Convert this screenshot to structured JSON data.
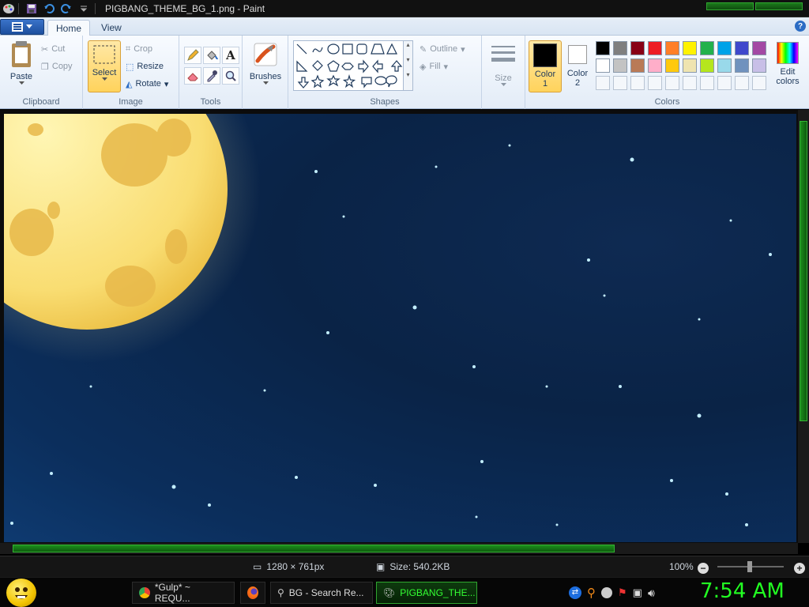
{
  "window": {
    "title": "PIGBANG_THEME_BG_1.png - Paint"
  },
  "tabs": {
    "home": "Home",
    "view": "View"
  },
  "clipboard": {
    "paste": "Paste",
    "cut": "Cut",
    "copy": "Copy",
    "label": "Clipboard"
  },
  "image_group": {
    "select": "Select",
    "crop": "Crop",
    "resize": "Resize",
    "rotate": "Rotate",
    "label": "Image"
  },
  "tools": {
    "label": "Tools"
  },
  "brushes": {
    "label": "Brushes"
  },
  "shapes": {
    "outline": "Outline",
    "fill": "Fill",
    "label": "Shapes"
  },
  "size": {
    "label": "Size"
  },
  "colors": {
    "color1_label": "Color",
    "color1_num": "1",
    "color2_label": "Color",
    "color2_num": "2",
    "edit_label_1": "Edit",
    "edit_label_2": "colors",
    "label": "Colors",
    "color1_value": "#000000",
    "color2_value": "#ffffff",
    "palette_row1": [
      "#000000",
      "#7f7f7f",
      "#880015",
      "#ed1c24",
      "#ff7f27",
      "#fff200",
      "#22b14c",
      "#00a2e8",
      "#3f48cc",
      "#a349a4"
    ],
    "palette_row2": [
      "#ffffff",
      "#c3c3c3",
      "#b97a57",
      "#ffaec9",
      "#ffc90e",
      "#efe4b0",
      "#b5e61d",
      "#99d9ea",
      "#7092be",
      "#c8bfe7"
    ]
  },
  "status": {
    "dimensions": "1280 × 761px",
    "file_size": "Size: 540.2KB",
    "zoom": "100%"
  },
  "taskbar": {
    "items": [
      "*Gulp* ~ REQU...",
      "BG - Search Re...",
      "PIGBANG_THE..."
    ],
    "clock": "7:54 AM"
  }
}
